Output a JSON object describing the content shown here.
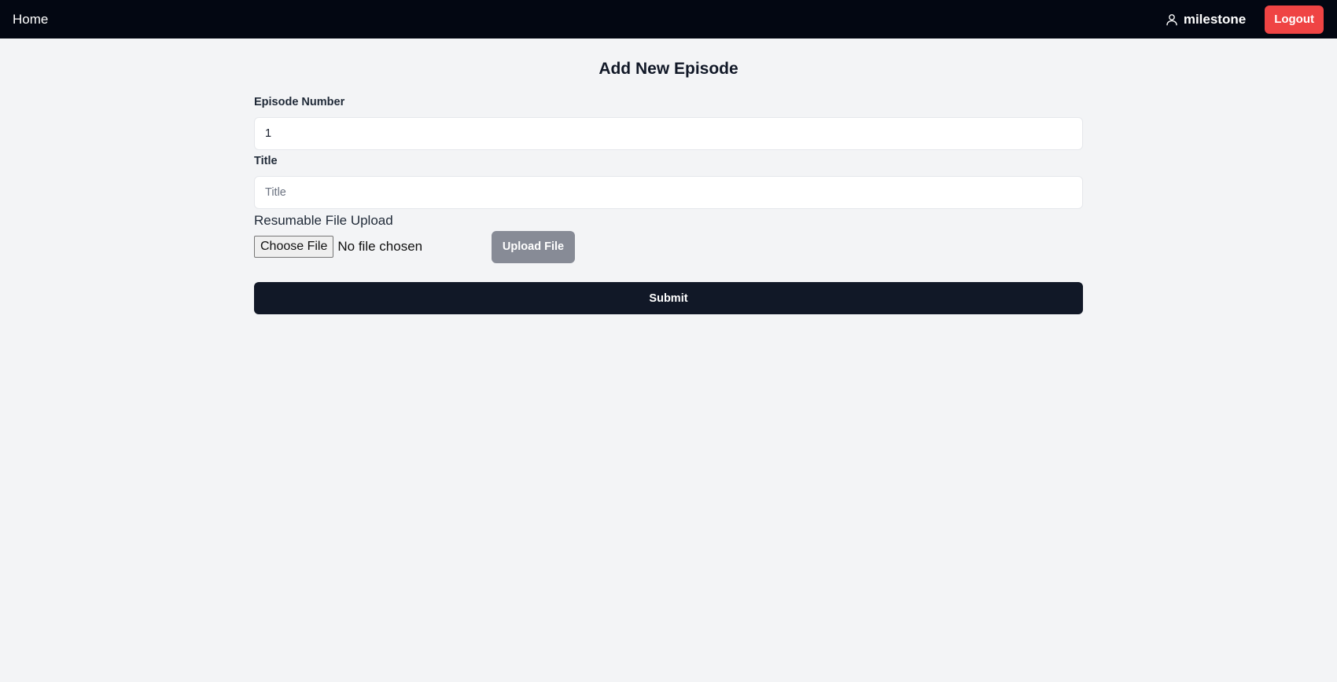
{
  "navbar": {
    "home_label": "Home",
    "user": {
      "icon": "user-icon",
      "name": "milestone"
    },
    "logout_label": "Logout"
  },
  "form": {
    "title": "Add New Episode",
    "episode_number": {
      "label": "Episode Number",
      "value": "1"
    },
    "title_field": {
      "label": "Title",
      "value": "",
      "placeholder": "Title"
    },
    "upload": {
      "label": "Resumable File Upload",
      "choose_file_label": "Choose File",
      "file_status": "No file chosen",
      "upload_button_label": "Upload File"
    },
    "submit_label": "Submit"
  },
  "colors": {
    "navbar_bg": "#030712",
    "page_bg": "#f3f4f6",
    "logout_bg": "#ef4444",
    "upload_btn_bg": "#878b96",
    "submit_bg": "#111827"
  }
}
